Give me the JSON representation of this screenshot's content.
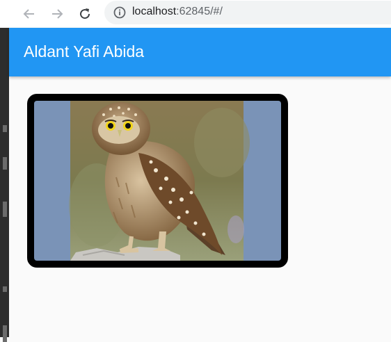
{
  "browser": {
    "back_icon": "arrow-back-icon",
    "forward_icon": "arrow-forward-icon",
    "reload_icon": "reload-icon",
    "site_info_icon": "info-icon",
    "url_host": "localhost",
    "url_rest": ":62845/#/"
  },
  "app_bar": {
    "title": "Aldant Yafi Abida",
    "color": "#2196f3"
  },
  "content": {
    "image_subject": "owl-photo",
    "frame_color": "#000000",
    "image_side_color": "#7a93b7"
  }
}
